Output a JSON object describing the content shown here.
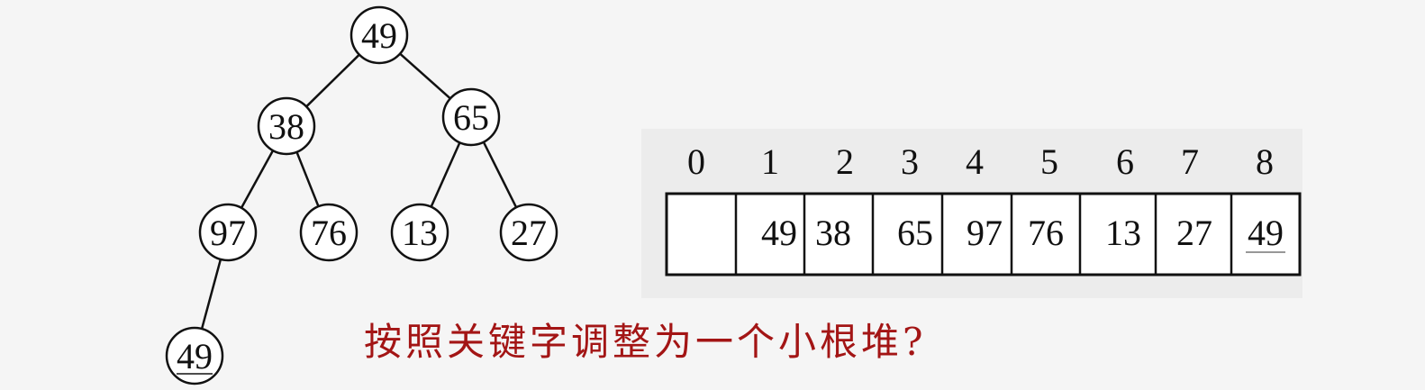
{
  "tree": {
    "nodes": [
      {
        "id": "n1",
        "label": "49"
      },
      {
        "id": "n2",
        "label": "38"
      },
      {
        "id": "n3",
        "label": "65"
      },
      {
        "id": "n4",
        "label": "97"
      },
      {
        "id": "n5",
        "label": "76"
      },
      {
        "id": "n6",
        "label": "13"
      },
      {
        "id": "n7",
        "label": "27"
      },
      {
        "id": "n8",
        "label": "49",
        "underlined": true
      }
    ],
    "edges": [
      [
        "n1",
        "n2"
      ],
      [
        "n1",
        "n3"
      ],
      [
        "n2",
        "n4"
      ],
      [
        "n2",
        "n5"
      ],
      [
        "n3",
        "n6"
      ],
      [
        "n3",
        "n7"
      ],
      [
        "n4",
        "n8"
      ]
    ]
  },
  "array": {
    "indices": [
      "0",
      "1",
      "2",
      "3",
      "4",
      "5",
      "6",
      "7",
      "8"
    ],
    "cells": [
      "",
      "49",
      "38",
      "65",
      "97",
      "76",
      "13",
      "27",
      "49"
    ],
    "underlined_index": 8
  },
  "question": "按照关键字调整为一个小根堆?"
}
